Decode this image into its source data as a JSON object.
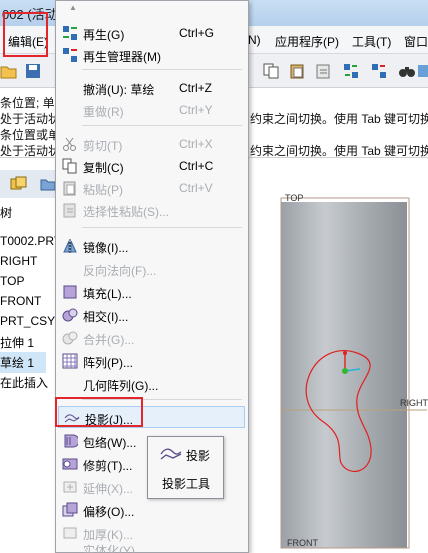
{
  "window": {
    "title": "002 (活动"
  },
  "menubar": {
    "items": [
      {
        "label": "编辑(E)"
      },
      {
        "label": "N)"
      },
      {
        "label": "应用程序(P)"
      },
      {
        "label": "工具(T)"
      },
      {
        "label": "窗口"
      }
    ]
  },
  "messages": {
    "left_lines": [
      "条位置; 单击",
      "处于活动状",
      "条位置或单",
      "处于活动状"
    ],
    "right_lines": [
      "约束之间切换。使用 Tab 键可切换活",
      "约束之间切换。使用 Tab 键可切换活"
    ]
  },
  "tree": {
    "header": "树",
    "items": [
      {
        "label": "T0002.PRT"
      },
      {
        "label": "RIGHT"
      },
      {
        "label": "TOP"
      },
      {
        "label": "FRONT"
      },
      {
        "label": "PRT_CSYS"
      },
      {
        "label": "拉伸 1"
      },
      {
        "label": "草绘 1"
      },
      {
        "label": "在此插入"
      }
    ]
  },
  "graphics": {
    "datum_top": "TOP",
    "datum_right": "RIGHT",
    "datum_front": "FRONT"
  },
  "edit_menu": {
    "scroll_up": "▲",
    "items": [
      {
        "label": "再生(G)",
        "shortcut": "Ctrl+G",
        "enabled": true,
        "icon": "regenerate-icon"
      },
      {
        "label": "再生管理器(M)",
        "shortcut": "",
        "enabled": true,
        "icon": "regen-manager-icon"
      },
      {
        "label": "撤消(U): 草绘",
        "shortcut": "Ctrl+Z",
        "enabled": true,
        "icon": ""
      },
      {
        "label": "重做(R)",
        "shortcut": "Ctrl+Y",
        "enabled": false,
        "icon": ""
      },
      {
        "label": "剪切(T)",
        "shortcut": "Ctrl+X",
        "enabled": false,
        "icon": "scissors-icon"
      },
      {
        "label": "复制(C)",
        "shortcut": "Ctrl+C",
        "enabled": true,
        "icon": "copy-icon"
      },
      {
        "label": "粘贴(P)",
        "shortcut": "Ctrl+V",
        "enabled": false,
        "icon": "paste-icon"
      },
      {
        "label": "选择性粘贴(S)...",
        "shortcut": "",
        "enabled": false,
        "icon": "paste-special-icon"
      },
      {
        "label": "镜像(I)...",
        "shortcut": "",
        "enabled": true,
        "icon": "mirror-icon"
      },
      {
        "label": "反向法向(F)...",
        "shortcut": "",
        "enabled": false,
        "icon": ""
      },
      {
        "label": "填充(L)...",
        "shortcut": "",
        "enabled": true,
        "icon": "fill-icon"
      },
      {
        "label": "相交(I)...",
        "shortcut": "",
        "enabled": true,
        "icon": "intersect-icon"
      },
      {
        "label": "合并(G)...",
        "shortcut": "",
        "enabled": false,
        "icon": "merge-icon"
      },
      {
        "label": "阵列(P)...",
        "shortcut": "",
        "enabled": true,
        "icon": "pattern-icon"
      },
      {
        "label": "几何阵列(G)...",
        "shortcut": "",
        "enabled": true,
        "icon": ""
      },
      {
        "label": "投影(J)...",
        "shortcut": "",
        "enabled": true,
        "icon": "project-icon"
      },
      {
        "label": "包络(W)...",
        "shortcut": "",
        "enabled": true,
        "icon": "wrap-icon"
      },
      {
        "label": "修剪(T)...",
        "shortcut": "",
        "enabled": true,
        "icon": "trim-icon"
      },
      {
        "label": "延伸(X)...",
        "shortcut": "",
        "enabled": false,
        "icon": "extend-icon"
      },
      {
        "label": "偏移(O)...",
        "shortcut": "",
        "enabled": true,
        "icon": "offset-icon"
      },
      {
        "label": "加厚(K)...",
        "shortcut": "",
        "enabled": false,
        "icon": "thicken-icon"
      },
      {
        "label": "实体化(Y)...",
        "shortcut": "",
        "enabled": false,
        "icon": ""
      }
    ]
  },
  "tooltip": {
    "title": "投影",
    "description": "投影工具"
  },
  "colors": {
    "highlight_box": "#e3262b",
    "sketch_curve": "#e02020",
    "hover_bg": "#e5f0fb"
  }
}
